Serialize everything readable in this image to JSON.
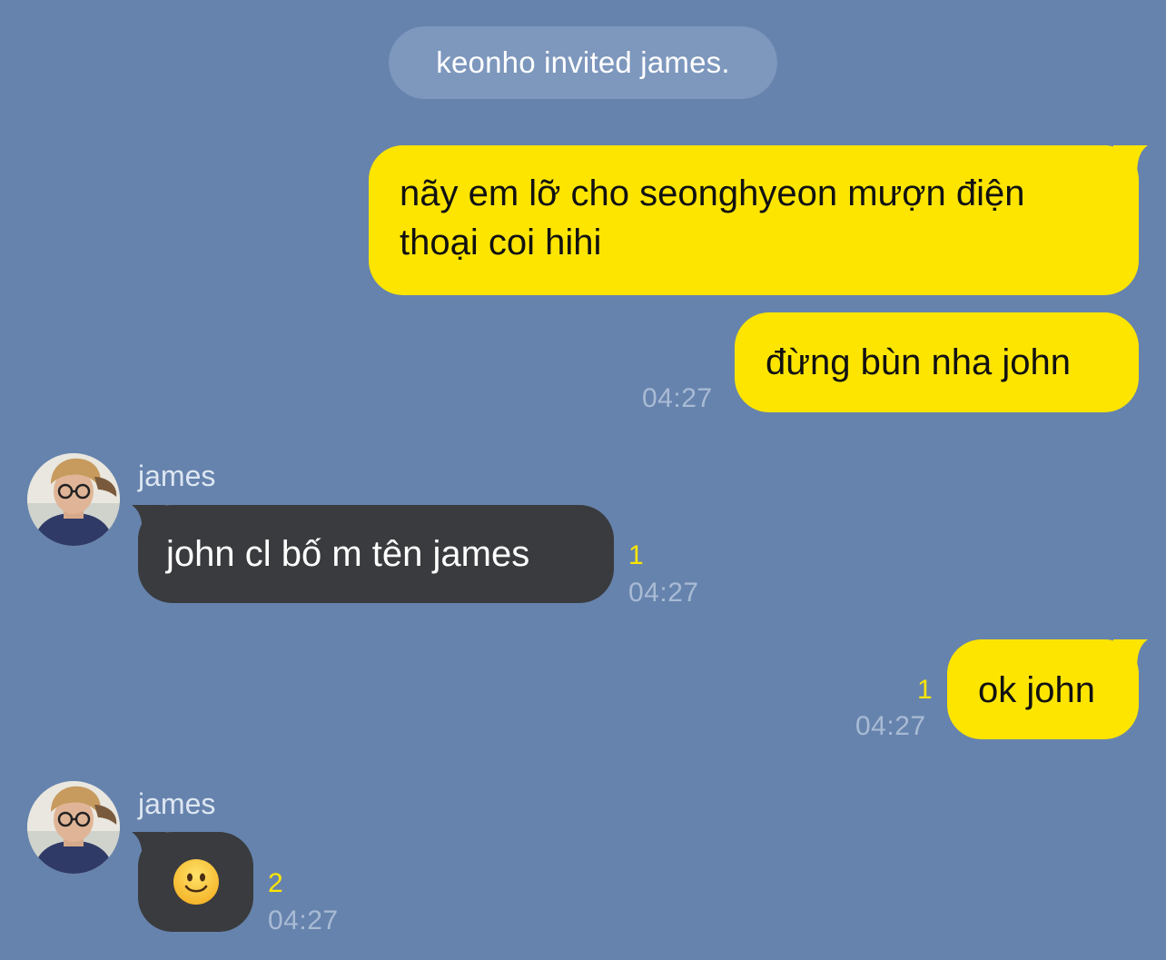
{
  "system_notice": "keonho invited james.",
  "messages": [
    {
      "text": "nãy em lỡ cho seonghyeon mượn điện thoại coi hihi",
      "line1": "nãy em lỡ cho seonghyeon mượn điện",
      "line2": "thoại coi hihi"
    },
    {
      "text": "đừng bùn nha john",
      "time": "04:27"
    },
    {
      "sender": "james",
      "text": "john cl bố m tên james",
      "unread": "1",
      "time": "04:27"
    },
    {
      "text": "ok john",
      "unread": "1",
      "time": "04:27"
    },
    {
      "sender": "james",
      "emoji": "slightly-smiling-face",
      "unread": "2",
      "time": "04:27"
    }
  ],
  "colors": {
    "background": "#6683ad",
    "outgoing_bubble": "#fee500",
    "incoming_bubble": "#3a3b3e",
    "unread_count": "#fee500",
    "timestamp": "#a9bbd4"
  }
}
